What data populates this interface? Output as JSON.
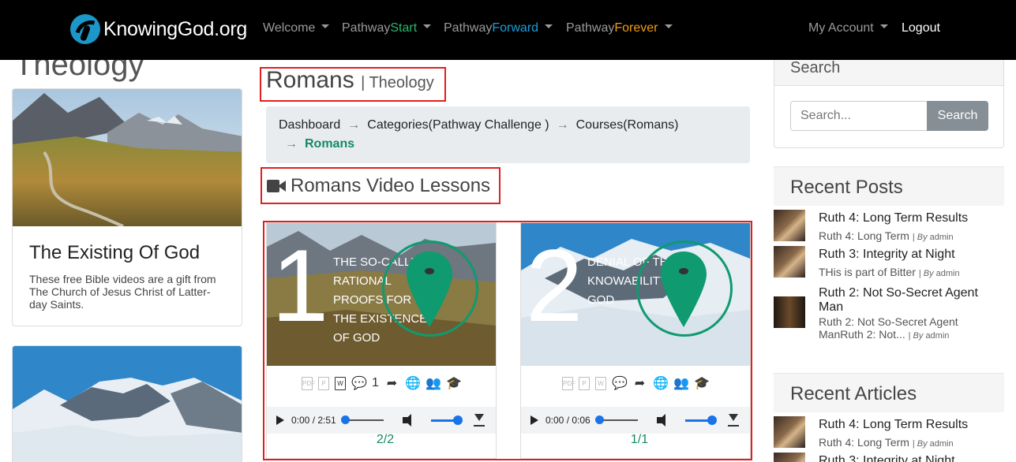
{
  "nav": {
    "logo_text": "KnowingGod.org",
    "items": [
      {
        "label": "Welcome"
      },
      {
        "prefix": "Pathway",
        "accent": "Start",
        "accent_color": "#28b96a"
      },
      {
        "prefix": "Pathway",
        "accent": "Forward",
        "accent_color": "#1b9fd8"
      },
      {
        "prefix": "Pathway",
        "accent": "Forever",
        "accent_color": "#f39c12"
      }
    ],
    "account": "My Account",
    "logout": "Logout"
  },
  "left": {
    "title": "Theology",
    "card": {
      "title": "The Existing Of God",
      "text": "These free Bible videos are a gift from The Church of Jesus Christ of Latter-day Saints."
    }
  },
  "main": {
    "title": "Romans",
    "subtitle": "| Theology",
    "breadcrumb": [
      "Dashboard",
      "Categories(Pathway Challenge )",
      "Courses(Romans)",
      "Romans"
    ],
    "breadcrumb_separator": "→",
    "lessons_title": "Romans Video Lessons",
    "videos": [
      {
        "number": "1",
        "thumb_text": "THE SO-CALLED RATIONAL PROOFS FOR THE EXISTENCE OF GOD",
        "comment_count": "1",
        "time": "0:00 / 2:51",
        "progress": 0.0,
        "page_count": "2/2"
      },
      {
        "number": "2",
        "thumb_text": "DENIAL OF THE KNOWABILITY OF GOD",
        "comment_count": "",
        "time": "0:00 / 0:06",
        "progress": 0.0,
        "page_count": "1/1"
      }
    ],
    "doc_icons": [
      "pdf-icon",
      "powerpoint-icon",
      "word-icon"
    ],
    "action_icons": [
      "comments-icon",
      "share-icon",
      "globe-icon",
      "users-icon",
      "graduation-cap-icon"
    ]
  },
  "sidebar": {
    "search_title": "Search",
    "search_placeholder": "Search...",
    "search_button": "Search",
    "recent_posts_title": "Recent Posts",
    "recent_posts": [
      {
        "title": "Ruth 4: Long Term Results",
        "excerpt": "Ruth 4: Long Term",
        "by": "By",
        "author": "admin"
      },
      {
        "title": "Ruth 3: Integrity at Night",
        "excerpt": "THis is part of Bitter",
        "by": "By",
        "author": "admin"
      },
      {
        "title": "Ruth 2: Not So-Secret Agent Man",
        "excerpt": "Ruth 2: Not So-Secret Agent ManRuth 2: Not...",
        "by": "By",
        "author": "admin"
      }
    ],
    "recent_articles_title": "Recent Articles",
    "recent_articles": [
      {
        "title": "Ruth 4: Long Term Results",
        "excerpt": "Ruth 4: Long Term",
        "by": "By",
        "author": "admin"
      },
      {
        "title": "Ruth 3: Integrity at Night"
      }
    ]
  },
  "colors": {
    "accent_green": "#138a63",
    "highlight_red": "#e02020",
    "navbar": "#000000"
  }
}
